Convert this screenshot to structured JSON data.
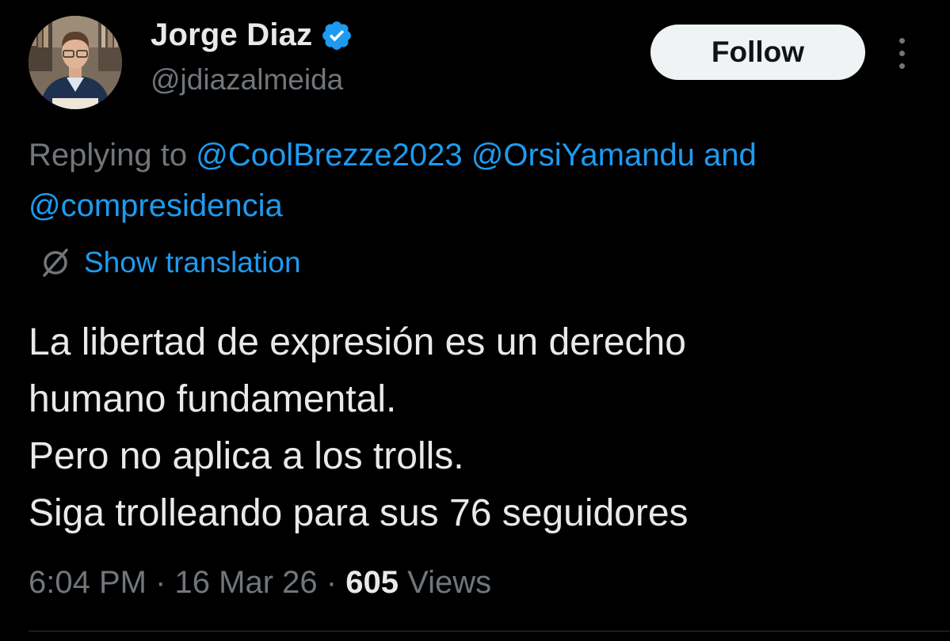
{
  "author": {
    "display_name": "Jorge Diaz",
    "handle": "@jdiazalmeida",
    "avatar_icon": "profile-photo",
    "verified_icon": "verified-badge-icon",
    "verified_color": "#1d9bf0"
  },
  "actions": {
    "follow_label": "Follow",
    "more_icon": "more-vertical-icon"
  },
  "reply_context": {
    "prefix": "Replying to",
    "mentions": [
      "@CoolBrezze2023",
      "@OrsiYamandu",
      "@compresidencia"
    ],
    "conjunction": "and"
  },
  "translation": {
    "icon": "translate-icon",
    "label": "Show translation"
  },
  "tweet": {
    "lines": [
      "La libertad de expresión es un derecho",
      "humano fundamental.",
      "Pero no aplica a los trolls.",
      "Siga trolleando para sus 76 seguidores"
    ]
  },
  "meta": {
    "time": "6:04 PM",
    "separator": "·",
    "date": "16 Mar 26",
    "views_count": "605",
    "views_label": "Views"
  },
  "colors": {
    "background": "#000000",
    "text_primary": "#e7e9ea",
    "text_secondary": "#71767b",
    "accent": "#1d9bf0",
    "button_bg": "#eff3f4"
  }
}
